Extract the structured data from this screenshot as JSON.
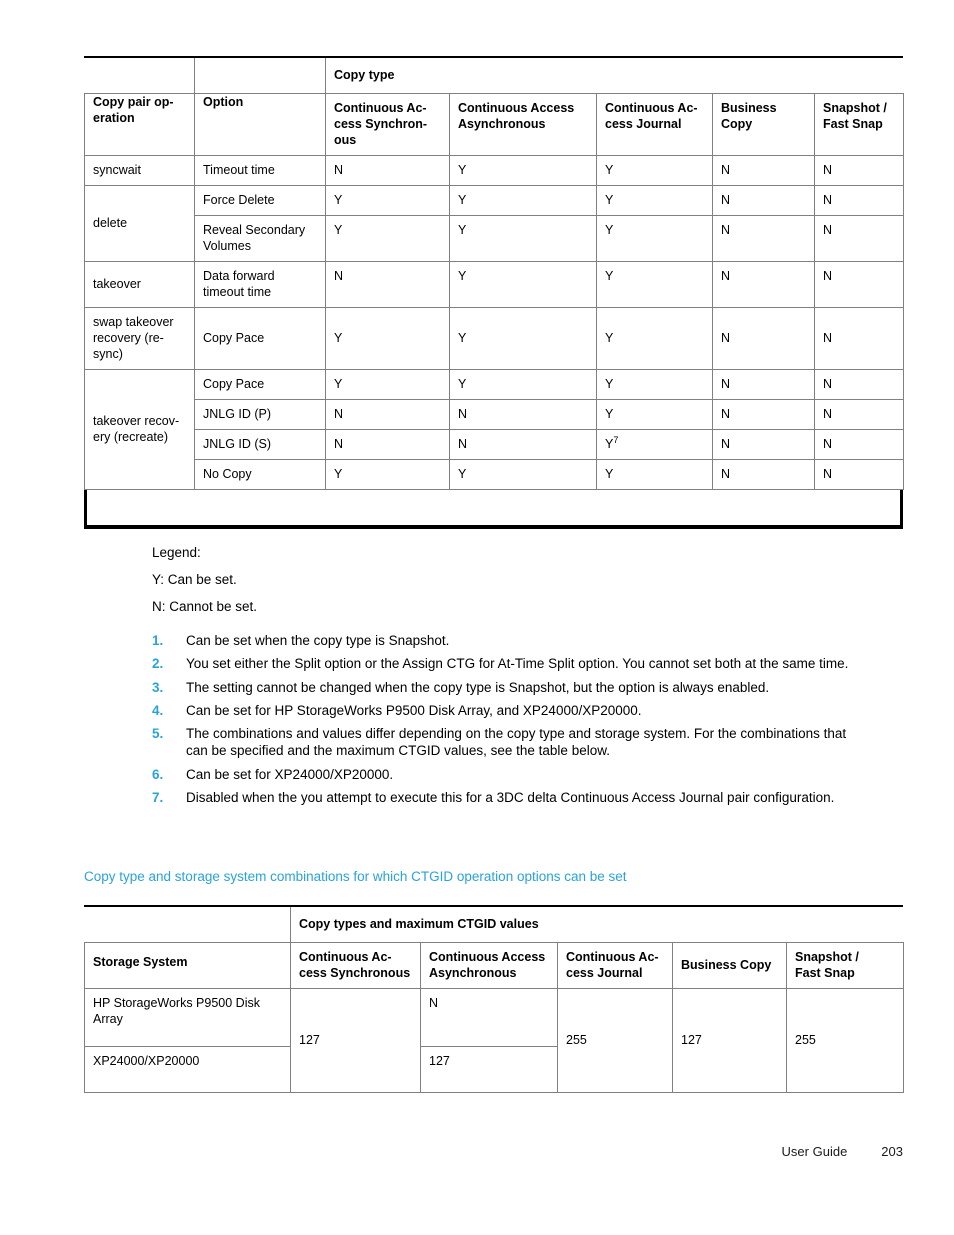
{
  "page": {
    "footer_label": "User Guide",
    "footer_page_number": "203",
    "accent_color": "#29A3D9",
    "link_color": "#29A3D9"
  },
  "table1": {
    "name": "copy-pair-operation-options-table",
    "group_header": "Copy type",
    "row_headers": [
      "Copy pair operation",
      "Option"
    ],
    "row_header_display": [
      "Copy pair op-\neration",
      "Option"
    ],
    "columns": [
      "Continuous Access Synchronous",
      "Continuous Access Asynchronous",
      "Continuous Access Journal",
      "Business Copy",
      "Snapshot / Fast Snap"
    ],
    "columns_display": [
      "Continuous Ac-\ncess Synchron-\nous",
      "Continuous Access\nAsynchronous",
      "Continuous Ac-\ncess Journal",
      "Business\nCopy",
      "Snapshot /\nFast Snap"
    ],
    "groups": [
      {
        "operation": "syncwait",
        "rows": [
          {
            "option": "Timeout time",
            "values": [
              "N",
              "Y",
              "Y",
              "N",
              "N"
            ]
          }
        ]
      },
      {
        "operation": "delete",
        "rows": [
          {
            "option": "Force Delete",
            "values": [
              "Y",
              "Y",
              "Y",
              "N",
              "N"
            ]
          },
          {
            "option": "Reveal Secondary Volumes",
            "values": [
              "Y",
              "Y",
              "Y",
              "N",
              "N"
            ]
          }
        ]
      },
      {
        "operation": "takeover",
        "rows": [
          {
            "option": "Data forward timeout time",
            "values": [
              "N",
              "Y",
              "Y",
              "N",
              "N"
            ]
          }
        ]
      },
      {
        "operation": "swap takeover recovery (re-sync)",
        "rows": [
          {
            "option": "Copy Pace",
            "values": [
              "Y",
              "Y",
              "Y",
              "N",
              "N"
            ]
          }
        ]
      },
      {
        "operation": "takeover recovery (recreate)",
        "rows": [
          {
            "option": "Copy Pace",
            "values": [
              "Y",
              "Y",
              "Y",
              "N",
              "N"
            ]
          },
          {
            "option": "JNLG ID (P)",
            "values": [
              "N",
              "N",
              "Y",
              "N",
              "N"
            ]
          },
          {
            "option": "JNLG ID (S)",
            "values": [
              "N",
              "N",
              "Y7",
              "N",
              "N"
            ],
            "footnote_col": 2,
            "footnote_marker": "7"
          },
          {
            "option": "No Copy",
            "values": [
              "Y",
              "Y",
              "Y",
              "N",
              "N"
            ]
          }
        ]
      }
    ]
  },
  "legend": {
    "title": "Legend:",
    "entries": [
      "Y: Can be set.",
      "N: Cannot be set."
    ],
    "notes": [
      {
        "num": "1.",
        "text": "Can be set when the copy type is Snapshot."
      },
      {
        "num": "2.",
        "text": "You set either the Split option or the Assign CTG for At-Time Split option. You cannot set both at the same time."
      },
      {
        "num": "3.",
        "text": "The setting cannot be changed when the copy type is Snapshot, but the option is always enabled."
      },
      {
        "num": "4.",
        "text": "Can be set for HP StorageWorks P9500 Disk Array, and XP24000/XP20000."
      },
      {
        "num": "5.",
        "text": "The combinations and values differ depending on the copy type and storage system. For the combinations that can be specified and the maximum CTGID values, see the table below."
      },
      {
        "num": "6.",
        "text": "Can be set for XP24000/XP20000."
      },
      {
        "num": "7.",
        "text": "Disabled when the you attempt to execute this for a 3DC delta Continuous Access Journal pair configuration."
      }
    ]
  },
  "caption": {
    "text": "Copy type and storage system combinations for which CTGID operation options can be set"
  },
  "table2": {
    "name": "ctgid-max-values-table",
    "group_header": "Copy types and maximum CTGID values",
    "row_header": "Storage System",
    "columns": [
      "Continuous Access Synchronous",
      "Continuous Access Asynchronous",
      "Continuous Access Journal",
      "Business Copy",
      "Snapshot / Fast Snap"
    ],
    "columns_display": [
      "Continuous Ac-\ncess Synchronous",
      "Continuous Access\nAsynchronous",
      "Continuous Ac-\ncess Journal",
      "Business Copy",
      "Snapshot /\nFast Snap"
    ],
    "systems": [
      "HP StorageWorks P9500 Disk Array",
      "XP24000/XP20000"
    ],
    "values": {
      "continuous_access_synchronous": "127",
      "continuous_access_asynchronous_p9500": "N",
      "continuous_access_asynchronous_xp": "127",
      "continuous_access_journal": "255",
      "business_copy": "127",
      "snapshot_fast_snap": "255"
    }
  }
}
